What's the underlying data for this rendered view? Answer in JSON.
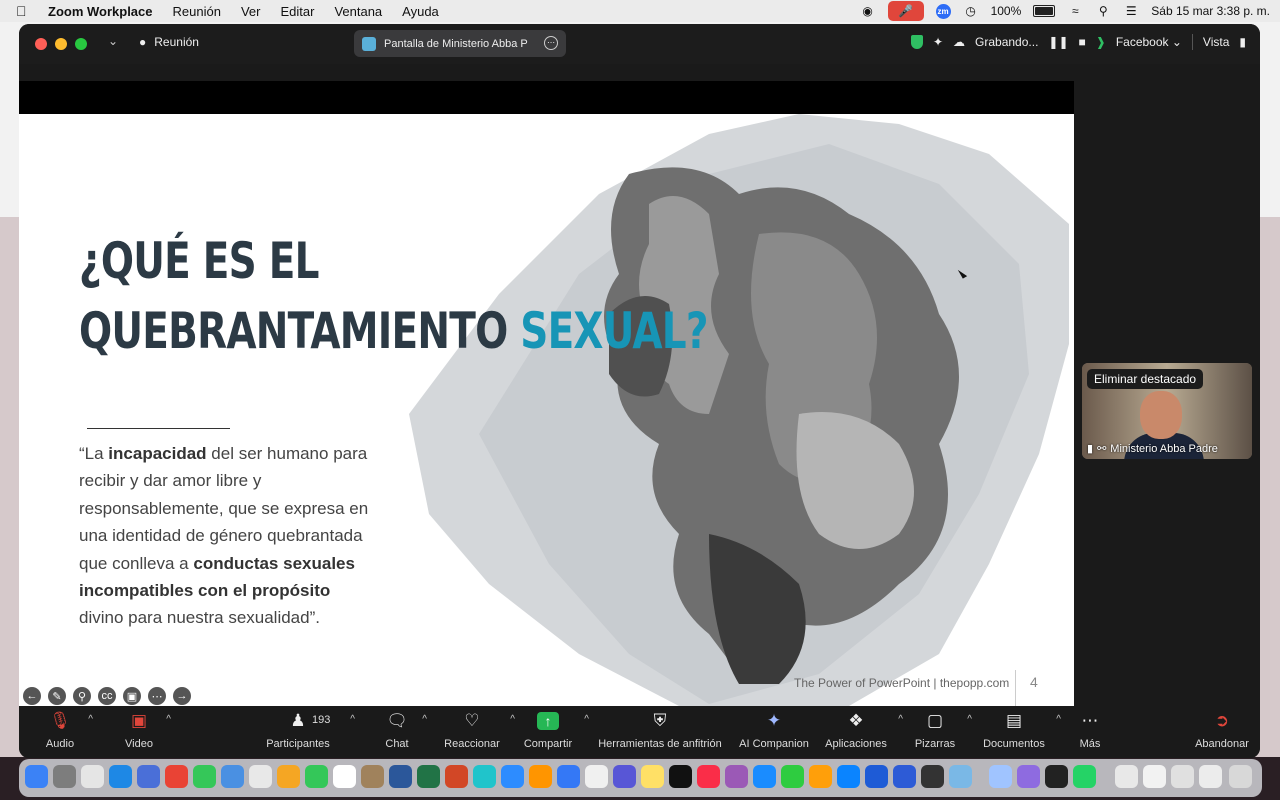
{
  "menubar": {
    "app_name": "Zoom Workplace",
    "items": [
      "Reunión",
      "Ver",
      "Editar",
      "Ventana",
      "Ayuda"
    ],
    "battery": "100%",
    "datetime": "Sáb 15 mar  3:38 p. m.",
    "zoom_badge": "zm"
  },
  "window": {
    "meeting_label": "Reunión",
    "share_title": "Pantalla de Ministerio Abba P",
    "recording_label": "Grabando...",
    "stream_label": "Facebook",
    "view_label": "Vista"
  },
  "slide": {
    "title_line1": "¿QUÉ ES EL",
    "title_line2_a": "QUEBRANTAMIENTO ",
    "title_line2_b": "SEXUAL?",
    "quote_1": "“La ",
    "quote_b1": "incapacidad",
    "quote_2": " del ser humano para recibir y dar amor libre y responsablemente, que se expresa en una identidad de género quebrantada que conlleva a ",
    "quote_b2": "conductas sexuales incompatibles con el propósito",
    "quote_3": " divino para nuestra sexualidad”.",
    "footer": "The Power of PowerPoint | thepopp.com",
    "page_number": "4"
  },
  "video": {
    "spotlight_badge": "Eliminar destacado",
    "participant_name": "Ministerio Abba Padre"
  },
  "controls": {
    "audio": "Audio",
    "video": "Video",
    "participants": "Participantes",
    "participant_count": "193",
    "chat": "Chat",
    "react": "Reaccionar",
    "share": "Compartir",
    "host_tools": "Herramientas de anfitrión",
    "ai": "AI Companion",
    "apps": "Aplicaciones",
    "whiteboards": "Pizarras",
    "docs": "Documentos",
    "more": "Más",
    "leave": "Abandonar"
  },
  "colors": {
    "accent": "#1795b6",
    "title_dark": "#2c3a45",
    "share_green": "#26b755",
    "mic_red": "#e0463b"
  }
}
